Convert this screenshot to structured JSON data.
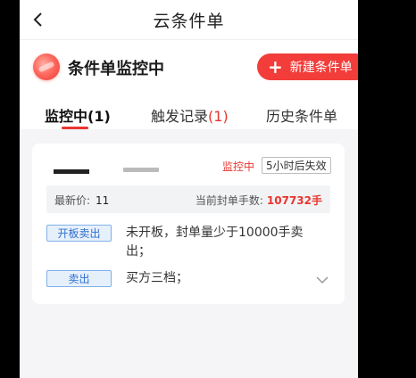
{
  "topbar": {
    "title": "云条件单"
  },
  "header": {
    "monitor_title": "条件单监控中",
    "new_button_label": "新建条件单"
  },
  "tabs": [
    {
      "label": "监控中",
      "count": "(1)"
    },
    {
      "label": "触发记录",
      "count": "(1)"
    },
    {
      "label": "历史条件单",
      "count": ""
    }
  ],
  "card": {
    "status": "监控中",
    "expire": "5小时后失效",
    "latest_price_label": "最新价:",
    "latest_price": "11",
    "seal_label": "当前封单手数:",
    "seal_value": "107732手",
    "conditions": [
      {
        "tag": "开板卖出",
        "text": "未开板，封单量少于10000手卖出；"
      },
      {
        "tag": "卖出",
        "text": "买方三档；"
      }
    ]
  },
  "colors": {
    "accent": "#f23d3a",
    "tag_blue": "#2f6fcf"
  },
  "icons": {
    "back": "chevron-left-icon",
    "plus": "plus-icon",
    "expand": "chevron-down-icon"
  }
}
